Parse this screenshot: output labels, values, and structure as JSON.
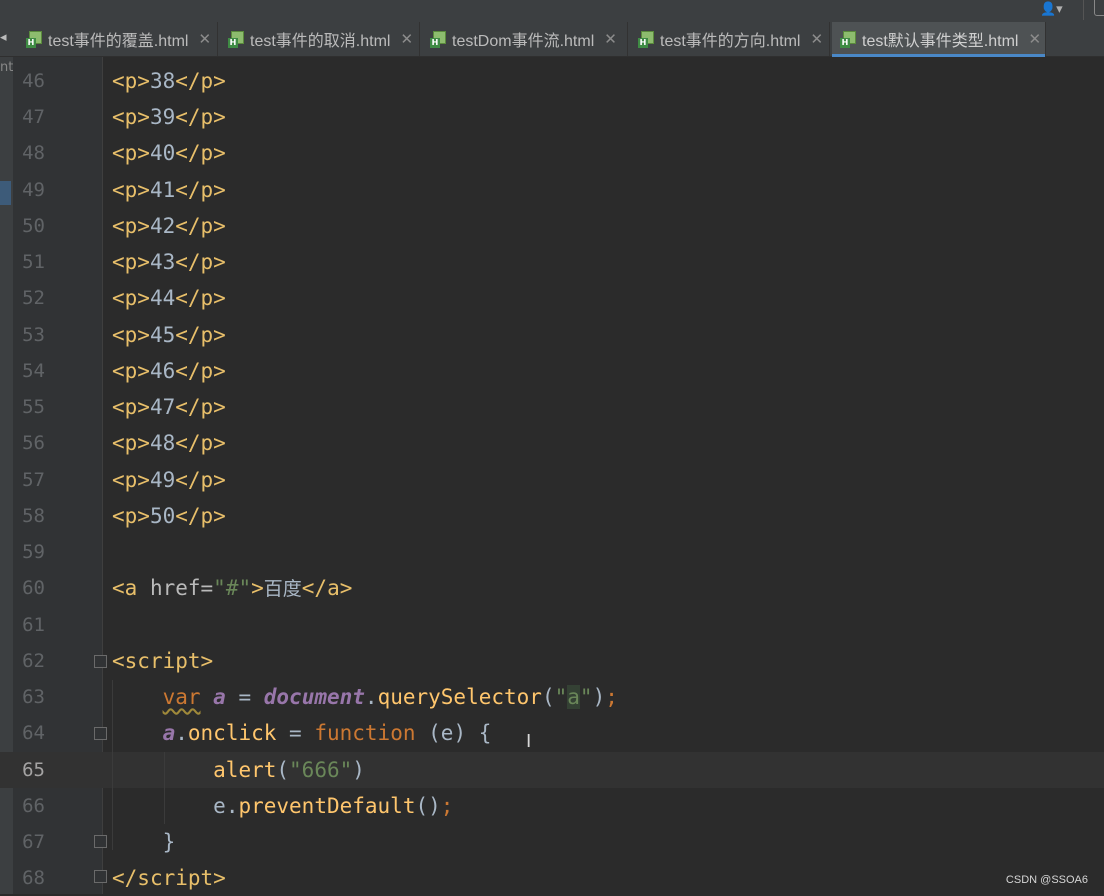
{
  "tabs": [
    {
      "label": "test事件的覆盖.html"
    },
    {
      "label": "test事件的取消.html"
    },
    {
      "label": "testDom事件流.html"
    },
    {
      "label": "test事件的方向.html"
    },
    {
      "label": "test默认事件类型.html"
    }
  ],
  "active_tab_index": 4,
  "left_cut_text": "nt",
  "editor": {
    "current_line": "65",
    "lines": [
      {
        "n": "46",
        "p_text": "38"
      },
      {
        "n": "47",
        "p_text": "39"
      },
      {
        "n": "48",
        "p_text": "40"
      },
      {
        "n": "49",
        "p_text": "41"
      },
      {
        "n": "50",
        "p_text": "42"
      },
      {
        "n": "51",
        "p_text": "43"
      },
      {
        "n": "52",
        "p_text": "44"
      },
      {
        "n": "53",
        "p_text": "45"
      },
      {
        "n": "54",
        "p_text": "46"
      },
      {
        "n": "55",
        "p_text": "47"
      },
      {
        "n": "56",
        "p_text": "48"
      },
      {
        "n": "57",
        "p_text": "49"
      },
      {
        "n": "58",
        "p_text": "50"
      }
    ],
    "l59": "59",
    "l60": {
      "n": "60",
      "attr": "href",
      "value": "\"#\"",
      "text": "百度"
    },
    "l61": "61",
    "l62": {
      "n": "62",
      "tag": "script"
    },
    "l63": {
      "n": "63",
      "kw": "var",
      "var": "a",
      "obj": "document",
      "method": "querySelector",
      "arg_open": "\"",
      "arg": "a",
      "arg_close": "\""
    },
    "l64": {
      "n": "64",
      "var": "a",
      "prop": "onclick",
      "kw": "function",
      "param": "(e) {"
    },
    "l65": {
      "n": "65",
      "fn": "alert",
      "arg": "\"666\""
    },
    "l66": {
      "n": "66",
      "obj": "e",
      "method": "preventDefault"
    },
    "l67": {
      "n": "67",
      "text": "}"
    },
    "l68": {
      "n": "68",
      "tag": "script"
    }
  },
  "watermark": "CSDN @SSOA6"
}
